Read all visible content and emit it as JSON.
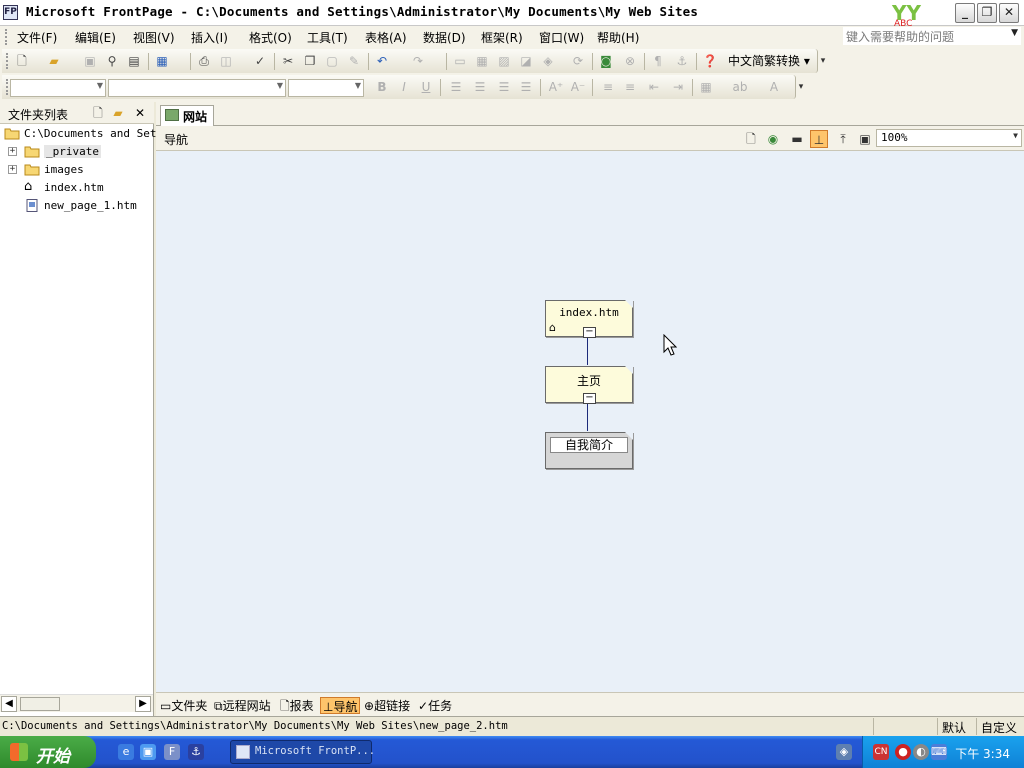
{
  "window": {
    "title": "Microsoft FrontPage - C:\\Documents and Settings\\Administrator\\My Documents\\My Web Sites",
    "minimize": "_",
    "restore": "❐",
    "close": "✕"
  },
  "menu": {
    "items": [
      "文件(F)",
      "编辑(E)",
      "视图(V)",
      "插入(I)",
      "格式(O)",
      "工具(T)",
      "表格(A)",
      "数据(D)",
      "框架(R)",
      "窗口(W)",
      "帮助(H)"
    ],
    "help_placeholder": "键入需要帮助的问题"
  },
  "toolbar": {
    "convert_label": "中文简繁转换"
  },
  "folder_list": {
    "title": "文件夹列表",
    "root": "C:\\Documents and Sett",
    "items": [
      {
        "label": "_private",
        "type": "folder",
        "expandable": true
      },
      {
        "label": "images",
        "type": "folder",
        "expandable": true
      },
      {
        "label": "index.htm",
        "type": "home"
      },
      {
        "label": "new_page_1.htm",
        "type": "page"
      }
    ]
  },
  "main": {
    "tab_label": "网站",
    "view_title": "导航",
    "zoom": "100%"
  },
  "navigation": {
    "nodes": [
      {
        "label": "index.htm",
        "home": true
      },
      {
        "label": "主页"
      },
      {
        "label": "自我简介"
      }
    ]
  },
  "bottom_tabs": [
    "文件夹",
    "远程网站",
    "报表",
    "导航",
    "超链接",
    "任务"
  ],
  "status": {
    "path": "C:\\Documents and Settings\\Administrator\\My Documents\\My Web Sites\\new_page_2.htm",
    "mode": "默认",
    "custom": "自定义"
  },
  "taskbar": {
    "start": "开始",
    "task_label": "Microsoft FrontP...",
    "clock": "下午 3:34"
  },
  "colors": {
    "accent": "#fec46b",
    "canvas": "#e9f0f8",
    "node": "#fdfbdb",
    "taskbar": "#2352cb"
  }
}
